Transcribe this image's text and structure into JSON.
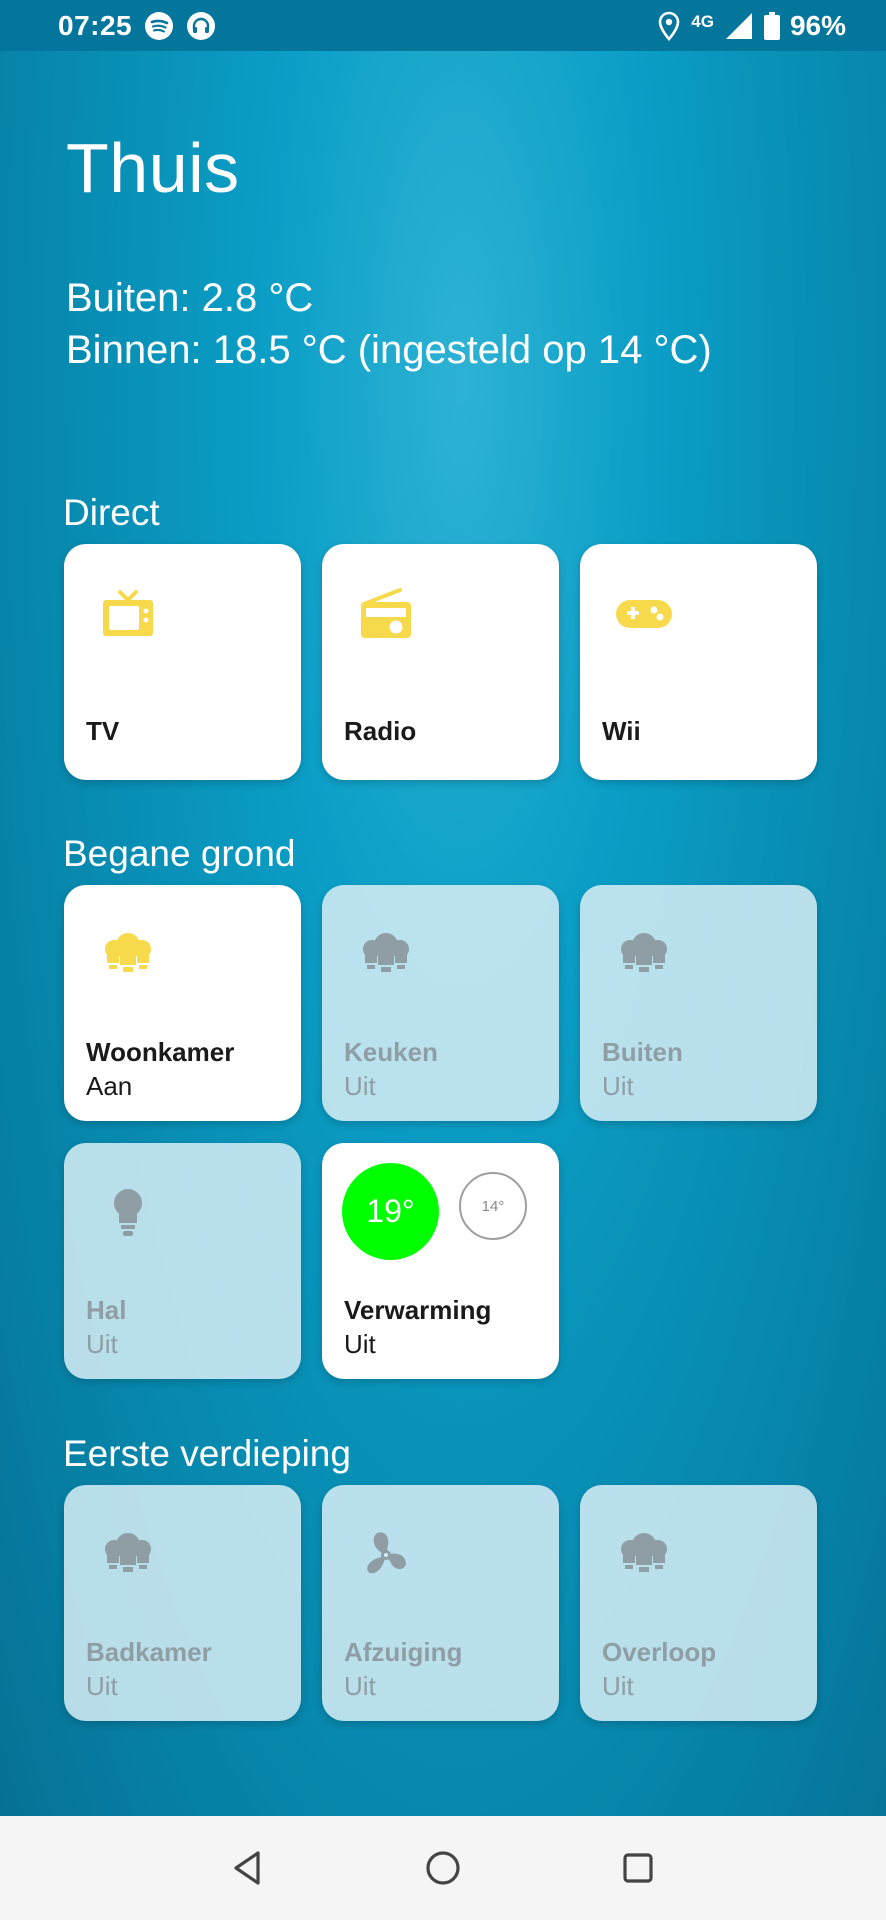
{
  "status_bar": {
    "time": "07:25",
    "network": "4G",
    "battery": "96%"
  },
  "header": {
    "title": "Thuis",
    "outside_temp": "Buiten: 2.8 °C",
    "inside_temp": "Binnen: 18.5 °C (ingesteld op 14 °C)"
  },
  "sections": {
    "direct": {
      "label": "Direct",
      "items": [
        {
          "name": "TV",
          "icon": "tv-icon"
        },
        {
          "name": "Radio",
          "icon": "radio-icon"
        },
        {
          "name": "Wii",
          "icon": "gamepad-icon"
        }
      ]
    },
    "ground": {
      "label": "Begane grond",
      "items": [
        {
          "name": "Woonkamer",
          "state": "Aan",
          "icon": "light-group-icon"
        },
        {
          "name": "Keuken",
          "state": "Uit",
          "icon": "light-group-icon"
        },
        {
          "name": "Buiten",
          "state": "Uit",
          "icon": "light-group-icon"
        },
        {
          "name": "Hal",
          "state": "Uit",
          "icon": "bulb-icon"
        },
        {
          "name": "Verwarming",
          "state": "Uit",
          "current": "19°",
          "target": "14°"
        }
      ]
    },
    "first": {
      "label": "Eerste verdieping",
      "items": [
        {
          "name": "Badkamer",
          "state": "Uit",
          "icon": "light-group-icon"
        },
        {
          "name": "Afzuiging",
          "state": "Uit",
          "icon": "fan-icon"
        },
        {
          "name": "Overloop",
          "state": "Uit",
          "icon": "light-group-icon"
        }
      ]
    }
  },
  "colors": {
    "accent_on": "#f7d94c",
    "icon_off": "#8f9ea4",
    "heating_current": "#00ff00"
  }
}
